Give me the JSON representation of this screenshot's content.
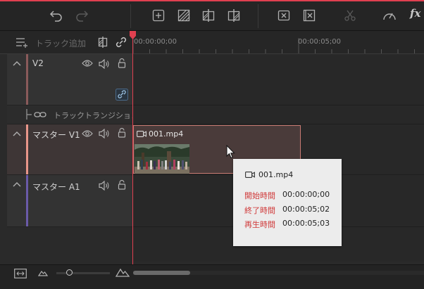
{
  "toolbar": {
    "icons": [
      "undo-icon",
      "redo-icon",
      "add-marker-icon",
      "split-clip-icon",
      "split-left-icon",
      "split-right-icon",
      "delete-icon",
      "ripple-delete-icon",
      "scissors-icon",
      "speed-icon",
      "fx-icon"
    ],
    "fx_label": "fx"
  },
  "timeline_header": {
    "add_track_label": "トラック追加",
    "timecodes": [
      "00:00:00;00",
      "00:00:05;00"
    ]
  },
  "tracks": {
    "v2": {
      "name": "V2"
    },
    "transition": {
      "label": "トラックトランジション"
    },
    "master_v1": {
      "name": "マスター V1"
    },
    "master_a1": {
      "name": "マスター A1"
    }
  },
  "clip": {
    "filename": "001.mp4"
  },
  "tooltip": {
    "filename": "001.mp4",
    "rows": [
      {
        "label": "開始時間",
        "value": "00:00:00;00"
      },
      {
        "label": "終了時間",
        "value": "00:00:05;02"
      },
      {
        "label": "再生時間",
        "value": "00:00:05;03"
      }
    ]
  },
  "colors": {
    "accent_red": "#e04050",
    "v2_bar": "#8a5a5a",
    "v1_bar": "#e8968a",
    "a1_bar": "#6a5aa8",
    "tooltip_label": "#d03a3a"
  },
  "zoom_slider": {
    "level": 0.25
  }
}
